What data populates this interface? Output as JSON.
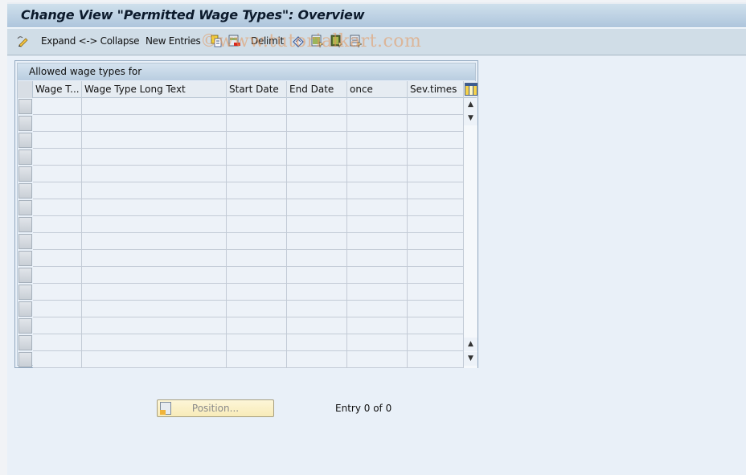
{
  "window": {
    "title": "Change View \"Permitted Wage Types\": Overview"
  },
  "toolbar": {
    "items": [
      {
        "type": "icon",
        "icon": "change-display-icon"
      },
      {
        "type": "button",
        "label": "Expand <-> Collapse"
      },
      {
        "type": "button",
        "label": "New Entries"
      },
      {
        "type": "icon",
        "icon": "copy-as-icon"
      },
      {
        "type": "icon",
        "icon": "delete-icon"
      },
      {
        "type": "button",
        "label": "Delimit"
      },
      {
        "type": "icon",
        "icon": "undo-change-icon"
      },
      {
        "type": "icon",
        "icon": "select-all-icon"
      },
      {
        "type": "icon",
        "icon": "select-block-icon"
      },
      {
        "type": "icon",
        "icon": "deselect-all-icon"
      }
    ],
    "expand_collapse_label": "Expand <-> Collapse",
    "new_entries_label": "New Entries",
    "delimit_label": "Delimit"
  },
  "watermark": "©www.tutorialkart.com",
  "table": {
    "caption": "Allowed wage types for",
    "columns": [
      "Wage T...",
      "Wage Type Long Text",
      "Start Date",
      "End Date",
      "once",
      "Sev.times"
    ],
    "visible_row_count": 16,
    "rows": []
  },
  "footer": {
    "position_button_label": "Position...",
    "entry_status": "Entry 0 of 0"
  },
  "colors": {
    "title_bar": "#b9cde0",
    "toolbar": "#d0dde7",
    "background": "#e9f0f8",
    "position_button": "#f8ebb8"
  }
}
